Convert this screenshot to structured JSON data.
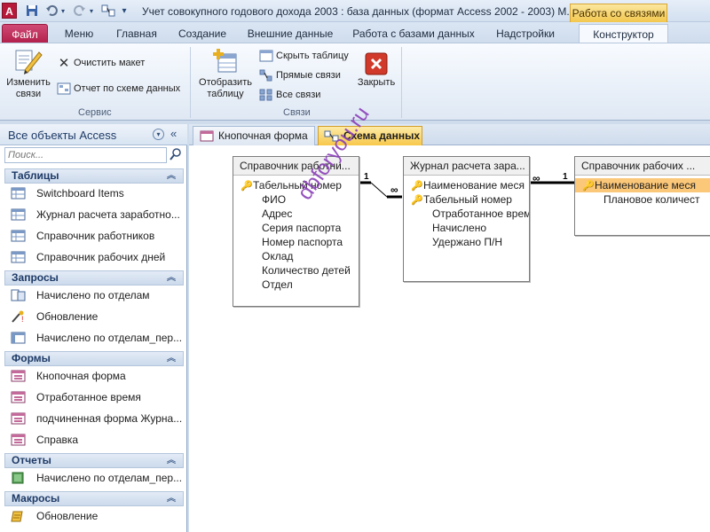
{
  "title_bar": {
    "app_icon": "A",
    "title": "Учет совокупного годового дохода 2003 : база данных (формат Access 2002 - 2003) M.",
    "context_tab_title": "Работа со связями",
    "quick_access": [
      "save-icon",
      "undo-icon",
      "redo-icon",
      "customize-icon"
    ]
  },
  "ribbon_tabs": {
    "file": "Файл",
    "menu": "Меню",
    "home": "Главная",
    "create": "Создание",
    "external": "Внешние данные",
    "db_tools": "Работа с базами данных",
    "addins": "Надстройки",
    "designer": "Конструктор"
  },
  "ribbon": {
    "group_service": {
      "label": "Сервис",
      "edit_relations": "Изменить\nсвязи",
      "clear_layout": "Очистить макет",
      "report": "Отчет по схеме данных"
    },
    "group_relations": {
      "label": "Связи",
      "show_table": "Отобразить\nтаблицу",
      "hide_table": "Скрыть таблицу",
      "direct_relations": "Прямые связи",
      "all_relations": "Все связи"
    },
    "close": "Закрыть"
  },
  "nav": {
    "title": "Все объекты Access",
    "search_placeholder": "Поиск...",
    "categories": [
      {
        "label": "Таблицы",
        "items": [
          "Switchboard Items",
          "Журнал расчета заработно...",
          "Справочник работников",
          "Справочник рабочих дней"
        ]
      },
      {
        "label": "Запросы",
        "items": [
          "Начислено по отделам",
          "Обновление",
          "Начислено по отделам_пер..."
        ]
      },
      {
        "label": "Формы",
        "items": [
          "Кнопочная форма",
          "Отработанное время",
          "подчиненная форма Журна...",
          "Справка"
        ]
      },
      {
        "label": "Отчеты",
        "items": [
          "Начислено по отделам_пер..."
        ]
      },
      {
        "label": "Макросы",
        "items": [
          "Обновление"
        ]
      }
    ]
  },
  "doc_tabs": {
    "tab1": "Кнопочная форма",
    "tab2": "Схема данных"
  },
  "schema": {
    "tables": [
      {
        "name": "Справочник работни...",
        "fields": [
          "Табельный номер",
          "ФИО",
          "Адрес",
          "Серия паспорта",
          "Номер паспорта",
          "Оклад",
          "Количество детей",
          "Отдел"
        ],
        "keys": [
          0
        ]
      },
      {
        "name": "Журнал расчета зара...",
        "fields": [
          "Наименование меся",
          "Табельный номер",
          "Отработанное время",
          "Начислено",
          "Удержано П/Н"
        ],
        "keys": [
          0,
          1
        ]
      },
      {
        "name": "Справочник рабочих ...",
        "fields": [
          "Наименование меся",
          "Плановое количест"
        ],
        "keys": [
          0
        ],
        "selected": 0
      }
    ],
    "relations": [
      {
        "one": "1",
        "many": "∞"
      },
      {
        "one": "1",
        "many": "∞"
      }
    ]
  },
  "watermark": "dbforyou.ru",
  "colors": {
    "file_tab": "#b3204c",
    "context_tab": "#f2c74d",
    "active_doc_tab": "#f7c84a",
    "selected_field": "#fbc778",
    "close_icon": "#d13a2a"
  }
}
